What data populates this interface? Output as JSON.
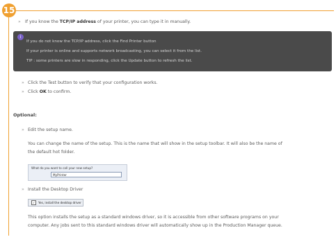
{
  "step_number": "15",
  "intro": {
    "pre": "If you know the ",
    "bold": "TCP/IP address",
    "post": " of your printer, you can type it in manually."
  },
  "note": {
    "icon": "info-icon",
    "lines": [
      "If you do not know the TCP/IP address, click the Find Printer button",
      "If your printer is online and supports network broadcasting, you can select it from the list.",
      "TIP : some printers are slow in responding, click the Update button to refresh the list."
    ]
  },
  "steps": {
    "test": "Click the Test button to verify that your configuration works.",
    "ok_pre": "Click ",
    "ok_bold": "OK",
    "ok_post": " to confirm."
  },
  "optional": {
    "heading": "Optional:",
    "edit_setup_name": "Edit the setup name.",
    "edit_desc_1": "You can change the name of the setup. This is the name that will show in the setup toolbar. It will also be the name of",
    "edit_desc_2": "the default hot folder.",
    "dialog_prompt": "What do you want to call your new setup?",
    "dialog_value": "MyPrinter",
    "install_driver": "Install the Desktop Driver",
    "checkbox_label": "Yes, install the desktop driver",
    "driver_desc_1": "This option installs the setup as a standard windows driver, so it is accessible from other software programs on your",
    "driver_desc_2": "computer. Any jobs sent to this standard windows driver will automatically show up in the Production Manager queue."
  },
  "colors": {
    "accent": "#f0a030",
    "note_bg": "#4a4a4a",
    "note_icon": "#7a62c8"
  }
}
